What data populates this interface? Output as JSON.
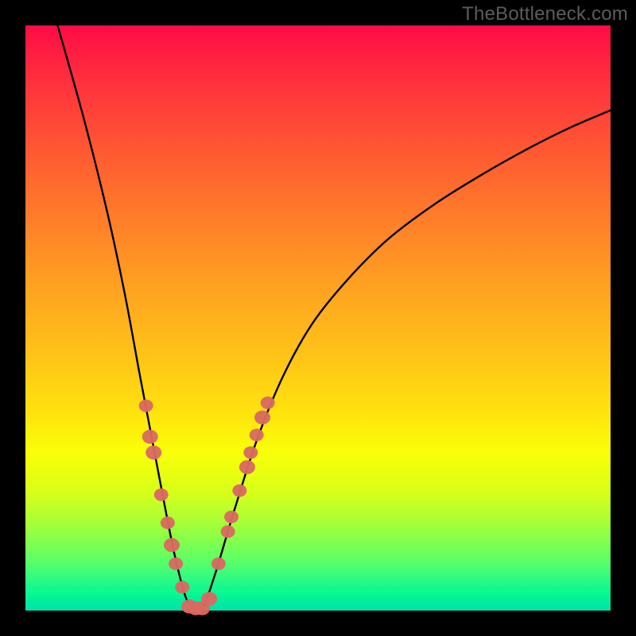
{
  "watermark": "TheBottleneck.com",
  "chart_data": {
    "type": "line",
    "title": "",
    "xlabel": "",
    "ylabel": "",
    "xlim": [
      0,
      1
    ],
    "ylim": [
      0,
      1
    ],
    "series": [
      {
        "name": "bottleneck-curve",
        "x": [
          0.055,
          0.1,
          0.14,
          0.17,
          0.195,
          0.215,
          0.235,
          0.255,
          0.275,
          0.29,
          0.305,
          0.325,
          0.355,
          0.395,
          0.44,
          0.49,
          0.55,
          0.62,
          0.7,
          0.78,
          0.86,
          0.93,
          1.0
        ],
        "y": [
          1.0,
          0.84,
          0.68,
          0.54,
          0.405,
          0.3,
          0.195,
          0.095,
          0.02,
          0.005,
          0.01,
          0.065,
          0.165,
          0.29,
          0.4,
          0.49,
          0.565,
          0.635,
          0.695,
          0.745,
          0.79,
          0.825,
          0.855
        ]
      }
    ],
    "markers": {
      "name": "highlighted-points",
      "color": "#d86a62",
      "points": [
        {
          "x": 0.206,
          "y": 0.35,
          "r": 9
        },
        {
          "x": 0.213,
          "y": 0.297,
          "r": 10
        },
        {
          "x": 0.219,
          "y": 0.27,
          "r": 10
        },
        {
          "x": 0.232,
          "y": 0.198,
          "r": 9
        },
        {
          "x": 0.243,
          "y": 0.15,
          "r": 9
        },
        {
          "x": 0.25,
          "y": 0.112,
          "r": 10
        },
        {
          "x": 0.257,
          "y": 0.08,
          "r": 9
        },
        {
          "x": 0.268,
          "y": 0.04,
          "r": 9
        },
        {
          "x": 0.28,
          "y": 0.007,
          "r": 10
        },
        {
          "x": 0.291,
          "y": 0.004,
          "r": 10
        },
        {
          "x": 0.302,
          "y": 0.004,
          "r": 10
        },
        {
          "x": 0.314,
          "y": 0.02,
          "r": 10
        },
        {
          "x": 0.33,
          "y": 0.08,
          "r": 9
        },
        {
          "x": 0.346,
          "y": 0.135,
          "r": 9
        },
        {
          "x": 0.352,
          "y": 0.16,
          "r": 9
        },
        {
          "x": 0.366,
          "y": 0.205,
          "r": 9
        },
        {
          "x": 0.379,
          "y": 0.245,
          "r": 10
        },
        {
          "x": 0.385,
          "y": 0.27,
          "r": 9
        },
        {
          "x": 0.395,
          "y": 0.3,
          "r": 9
        },
        {
          "x": 0.405,
          "y": 0.33,
          "r": 10
        },
        {
          "x": 0.414,
          "y": 0.355,
          "r": 9
        }
      ]
    },
    "gradient_stops": [
      {
        "pos": 0.0,
        "color": "#ff0b46"
      },
      {
        "pos": 0.73,
        "color": "#faff07"
      },
      {
        "pos": 0.96,
        "color": "#08f59a"
      },
      {
        "pos": 1.0,
        "color": "#00e7b0"
      }
    ]
  }
}
